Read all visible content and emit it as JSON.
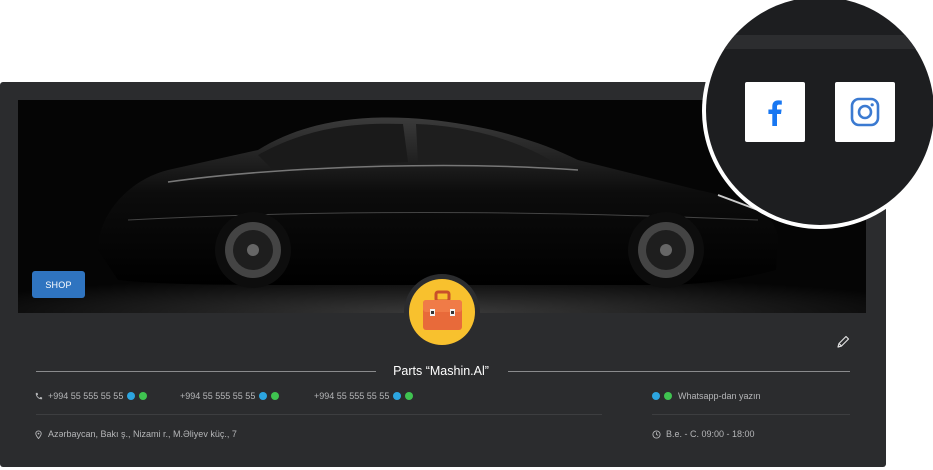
{
  "cover": {
    "badge_label": "SHOP"
  },
  "store": {
    "name": "Parts “Mashin.Al”"
  },
  "contacts": {
    "phones": [
      "+994 55 555 55 55",
      "+994 55 555 55 55",
      "+994 55 555 55 55"
    ],
    "whatsapp_text": "Whatsapp-dan yazın",
    "address": "Azərbaycan, Bakı ş., Nizami r., M.Əliyev küç., 7",
    "hours": "B.e. - C. 09:00 - 18:00"
  },
  "social": {
    "items": [
      "facebook-icon",
      "instagram-icon"
    ]
  },
  "colors": {
    "accent": "#2f74c0",
    "telegram": "#2ca5e0",
    "whatsapp": "#3fc350",
    "facebook": "#1877f2",
    "instagram": "#3b7ad1",
    "logo_bg": "#f8c12e",
    "logo_bag": "#e86a3a"
  }
}
